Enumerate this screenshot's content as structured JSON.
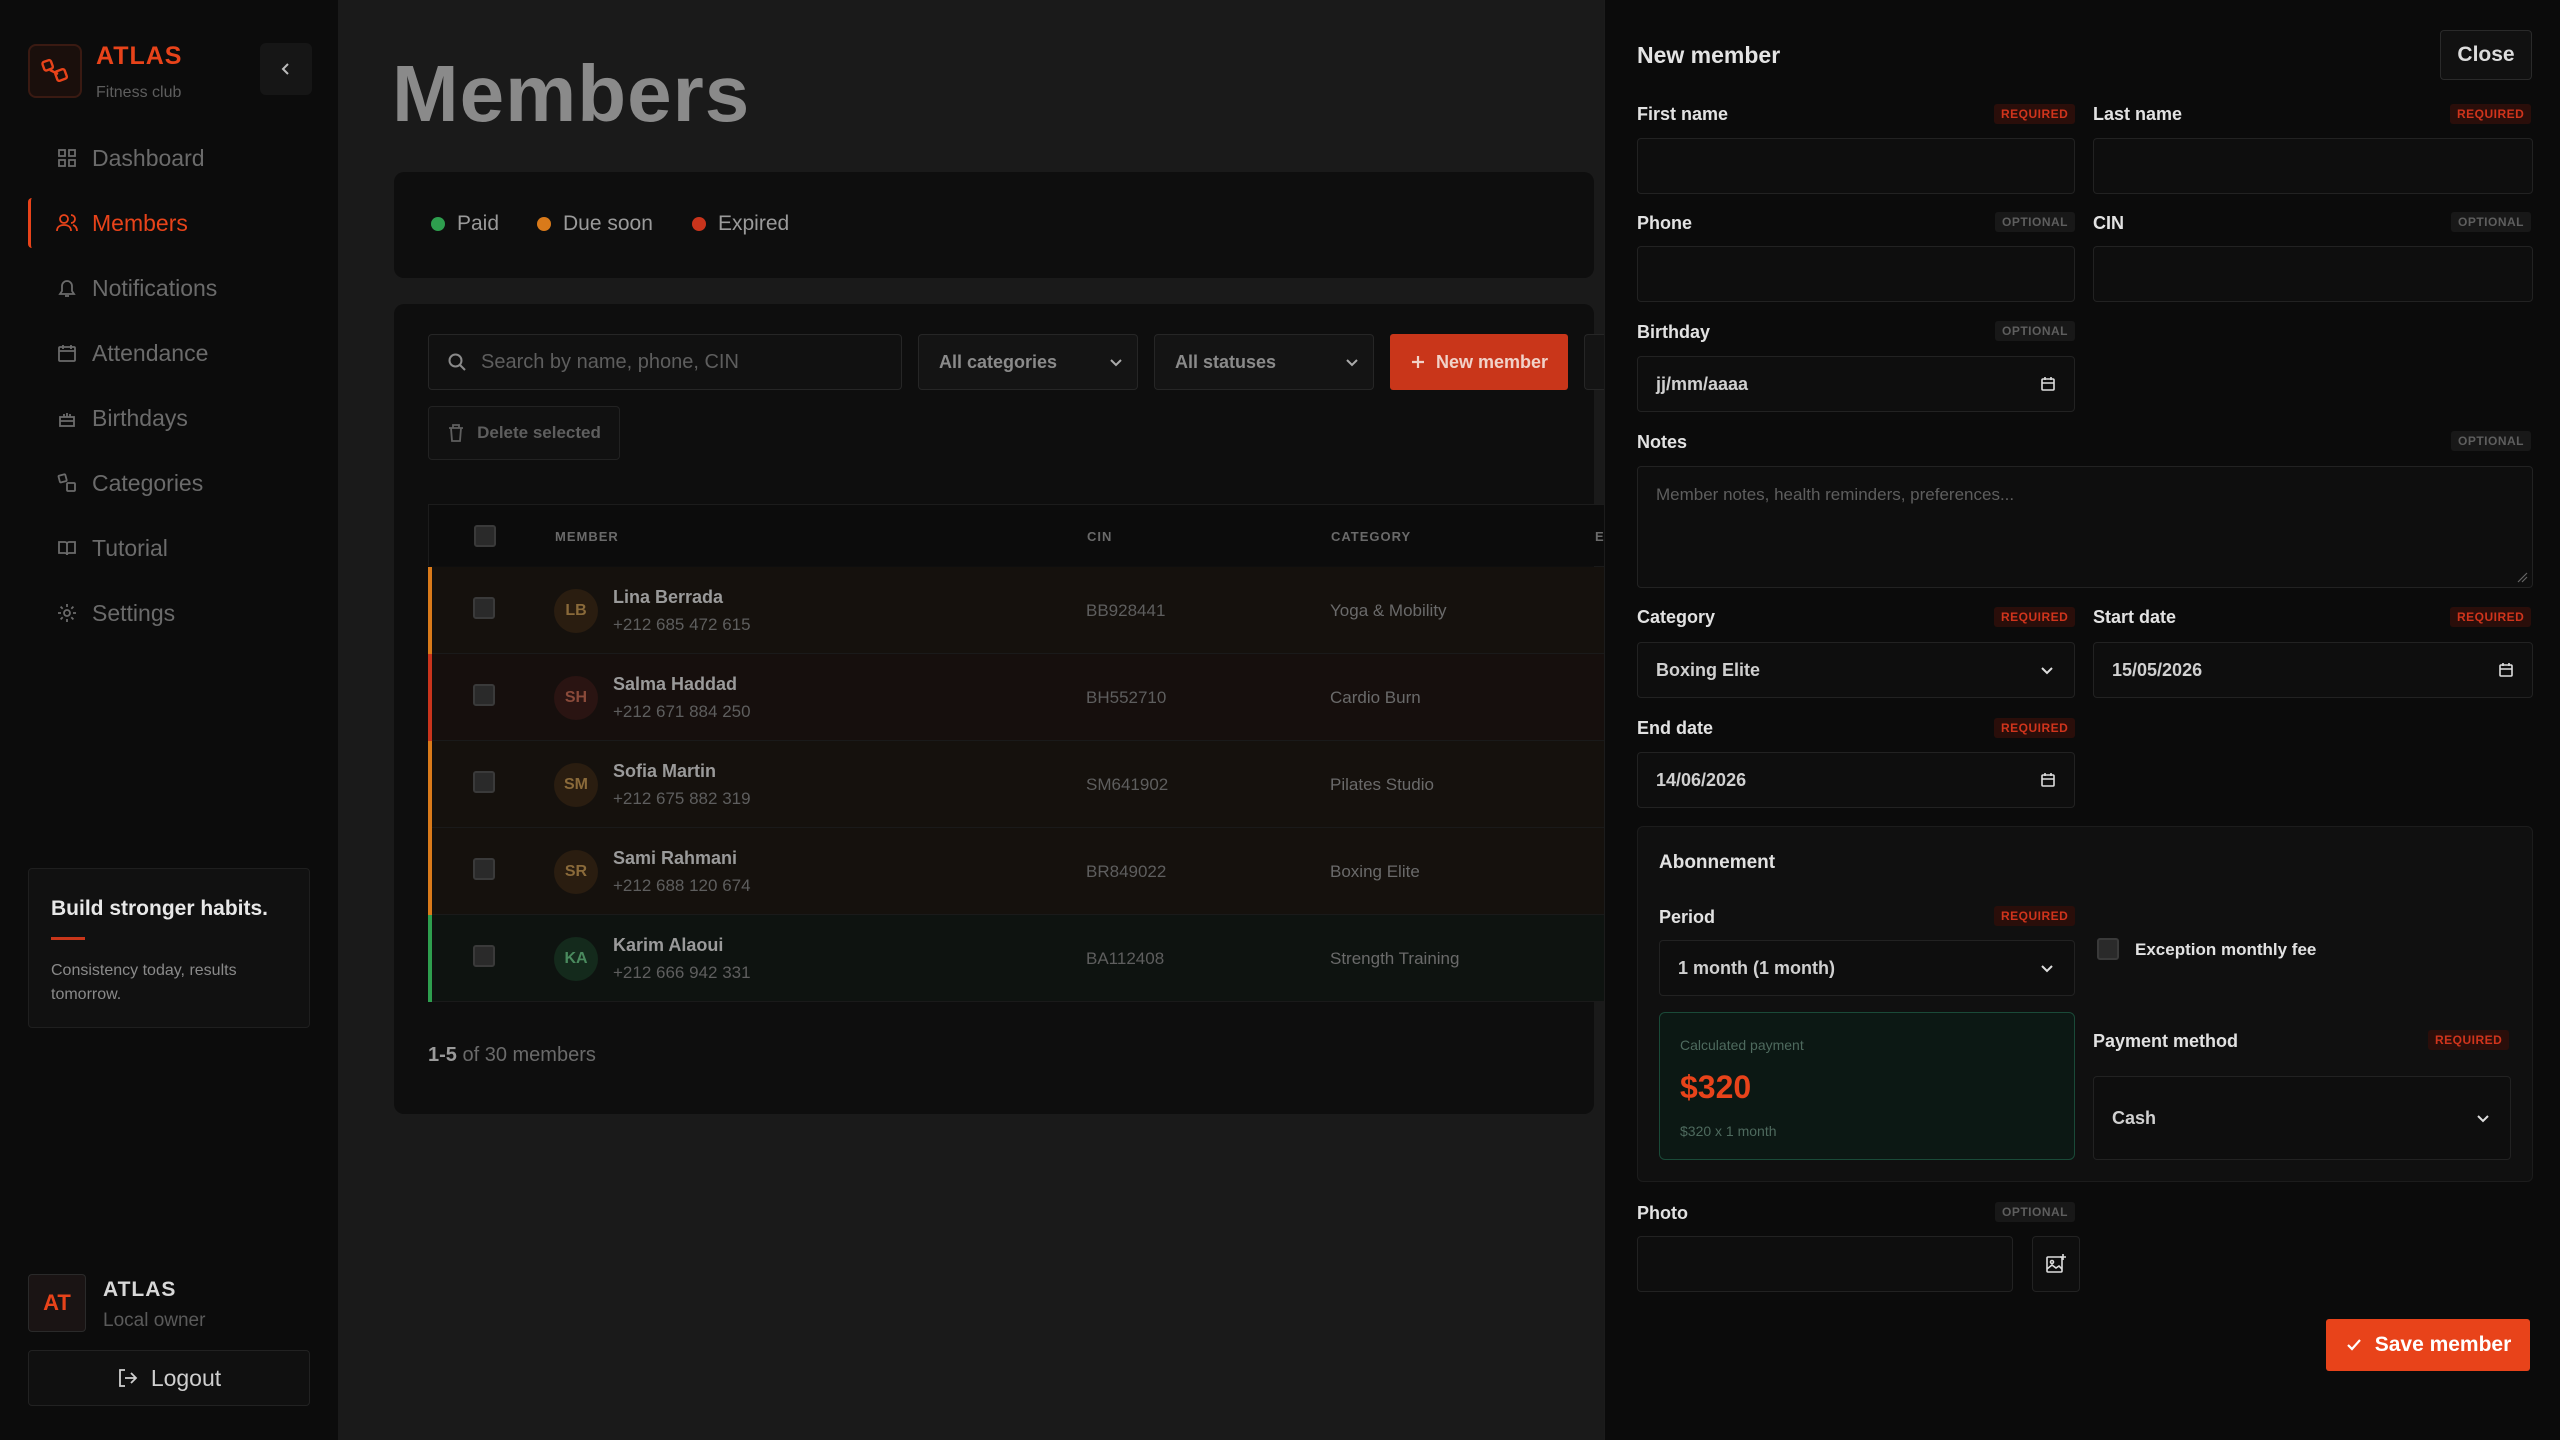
{
  "brand": {
    "name": "ATLAS",
    "subtitle": "Fitness club"
  },
  "nav": [
    {
      "label": "Dashboard",
      "icon": "dashboard-icon",
      "active": false
    },
    {
      "label": "Members",
      "icon": "users-icon",
      "active": true
    },
    {
      "label": "Notifications",
      "icon": "bell-icon",
      "active": false
    },
    {
      "label": "Attendance",
      "icon": "calendar-icon",
      "active": false
    },
    {
      "label": "Birthdays",
      "icon": "cake-icon",
      "active": false
    },
    {
      "label": "Categories",
      "icon": "categories-icon",
      "active": false
    },
    {
      "label": "Tutorial",
      "icon": "book-icon",
      "active": false
    },
    {
      "label": "Settings",
      "icon": "gear-icon",
      "active": false
    }
  ],
  "habit_card": {
    "title": "Build stronger habits.",
    "text": "Consistency today, results tomorrow."
  },
  "user": {
    "initials": "AT",
    "name": "ATLAS",
    "role": "Local owner"
  },
  "logout_label": "Logout",
  "page": {
    "title": "Members"
  },
  "legend": [
    {
      "label": "Paid",
      "color": "#2e9e4e"
    },
    {
      "label": "Due soon",
      "color": "#d97a1a"
    },
    {
      "label": "Expired",
      "color": "#c9341c"
    }
  ],
  "toolbar": {
    "search_placeholder": "Search by name, phone, CIN",
    "category_filter": "All categories",
    "status_filter": "All statuses",
    "new_member_label": "New member",
    "delete_selected_label": "Delete selected"
  },
  "table": {
    "headers": {
      "member": "MEMBER",
      "cin": "CIN",
      "category": "CATEGORY",
      "extra": "E"
    },
    "rows": [
      {
        "initials": "LB",
        "name": "Lina Berrada",
        "phone": "+212 685 472 615",
        "cin": "BB928441",
        "category": "Yoga & Mobility",
        "status_color": "#d97a1a"
      },
      {
        "initials": "SH",
        "name": "Salma Haddad",
        "phone": "+212 671 884 250",
        "cin": "BH552710",
        "category": "Cardio Burn",
        "status_color": "#c9341c"
      },
      {
        "initials": "SM",
        "name": "Sofia Martin",
        "phone": "+212 675 882 319",
        "cin": "SM641902",
        "category": "Pilates Studio",
        "status_color": "#d97a1a"
      },
      {
        "initials": "SR",
        "name": "Sami Rahmani",
        "phone": "+212 688 120 674",
        "cin": "BR849022",
        "category": "Boxing Elite",
        "status_color": "#d97a1a"
      },
      {
        "initials": "KA",
        "name": "Karim Alaoui",
        "phone": "+212 666 942 331",
        "cin": "BA112408",
        "category": "Strength Training",
        "status_color": "#2e9e4e"
      }
    ]
  },
  "pagination": {
    "range": "1-5",
    "text": "of 30 members"
  },
  "form": {
    "title": "New member",
    "close_label": "Close",
    "required_tag": "REQUIRED",
    "optional_tag": "OPTIONAL",
    "first_name": {
      "label": "First name",
      "value": ""
    },
    "last_name": {
      "label": "Last name",
      "value": ""
    },
    "phone": {
      "label": "Phone",
      "value": ""
    },
    "cin": {
      "label": "CIN",
      "value": ""
    },
    "birthday": {
      "label": "Birthday",
      "value": "jj/mm/aaaa"
    },
    "notes": {
      "label": "Notes",
      "placeholder": "Member notes, health reminders, preferences..."
    },
    "category": {
      "label": "Category",
      "value": "Boxing Elite"
    },
    "start_date": {
      "label": "Start date",
      "value": "15/05/2026"
    },
    "end_date": {
      "label": "End date",
      "value": "14/06/2026"
    },
    "abonnement": {
      "title": "Abonnement",
      "period": {
        "label": "Period",
        "value": "1 month (1 month)"
      },
      "exception_label": "Exception monthly fee",
      "calculated": {
        "label": "Calculated payment",
        "value": "$320",
        "detail": "$320 x 1 month"
      },
      "payment_method": {
        "label": "Payment method",
        "value": "Cash"
      }
    },
    "photo": {
      "label": "Photo"
    },
    "save_label": "Save member"
  },
  "colors": {
    "accent": "#e8431a",
    "background": "#1a1a1a",
    "panel": "#0b0b0b"
  }
}
